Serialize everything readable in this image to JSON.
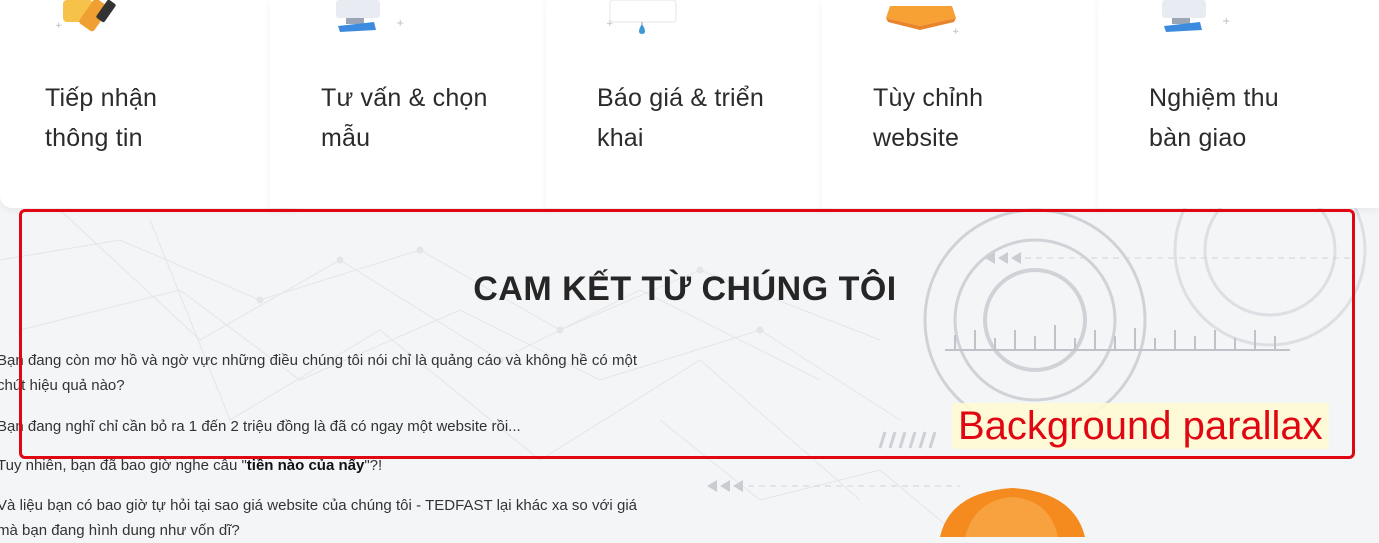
{
  "steps": [
    {
      "title_line1": "Tiếp nhận",
      "title_line2": "thông tin"
    },
    {
      "title_line1": "Tư vấn & chọn",
      "title_line2": "mẫu"
    },
    {
      "title_line1": "Báo giá & triển",
      "title_line2": "khai"
    },
    {
      "title_line1": "Tùy chỉnh",
      "title_line2": "website"
    },
    {
      "title_line1": "Nghiệm thu",
      "title_line2": "bàn giao"
    }
  ],
  "section": {
    "title": "CAM KẾT TỪ CHÚNG TÔI",
    "paragraphs": {
      "p1": "Bạn đang còn mơ hồ và ngờ vực những điều chúng tôi nói chỉ là quảng cáo và không hề có một chút hiệu quả nào?",
      "p2": "Bạn đang nghĩ chỉ cần bỏ ra 1 đến 2 triệu đồng là đã có ngay một website rồi...",
      "p3_before": "Tuy nhiên, bạn đã bao giờ nghe câu \"",
      "p3_bold": "tiền nào của nấy",
      "p3_after": "\"?!",
      "p4": "Và liệu bạn có bao giờ tự hỏi tại sao giá website của chúng tôi - TEDFAST lại khác xa so với giá mà bạn đang hình dung như vốn dĩ?"
    }
  },
  "annotation": {
    "label": "Background parallax",
    "color": "#e00712"
  },
  "icons": [
    "pencil-notepad-icon",
    "computer-monitor-icon",
    "price-tag-icon",
    "layers-box-icon",
    "computer-monitor-icon",
    "gear-icon",
    "construction-helmet-icon"
  ]
}
